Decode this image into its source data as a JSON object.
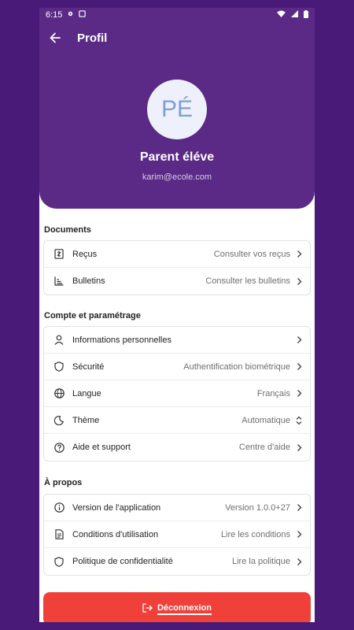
{
  "status_bar": {
    "time": "6:15"
  },
  "app_bar": {
    "title": "Profil"
  },
  "profile": {
    "initials": "PÉ",
    "name": "Parent éléve",
    "email": "karim@ecole.com"
  },
  "sections": [
    {
      "title": "Documents",
      "items": [
        {
          "label": "Reçus",
          "value": "Consulter vos reçus",
          "icon": "receipt-icon",
          "chevron": "chevron-right-icon"
        },
        {
          "label": "Bulletins",
          "value": "Consulter les bulletins",
          "icon": "bar-chart-icon",
          "chevron": "chevron-right-icon"
        }
      ]
    },
    {
      "title": "Compte et paramétrage",
      "items": [
        {
          "label": "Informations personnelles",
          "value": "",
          "icon": "person-icon",
          "chevron": "chevron-right-icon"
        },
        {
          "label": "Sécurité",
          "value": "Authentification biométrique",
          "icon": "shield-icon",
          "chevron": "chevron-right-icon"
        },
        {
          "label": "Langue",
          "value": "Français",
          "icon": "globe-icon",
          "chevron": "chevron-right-icon"
        },
        {
          "label": "Thème",
          "value": "Automatique",
          "icon": "moon-icon",
          "chevron": "chevron-updown-icon"
        },
        {
          "label": "Aide et support",
          "value": "Centre d'aide",
          "icon": "help-circle-icon",
          "chevron": "chevron-right-icon"
        }
      ]
    },
    {
      "title": "À propos",
      "items": [
        {
          "label": "Version de l'application",
          "value": "Version 1.0.0+27",
          "icon": "info-icon",
          "chevron": "chevron-right-icon"
        },
        {
          "label": "Conditions d'utilisation",
          "value": "Lire les conditions",
          "icon": "document-icon",
          "chevron": "chevron-right-icon"
        },
        {
          "label": "Politique de confidentialité",
          "value": "Lire la politique",
          "icon": "shield-icon",
          "chevron": "chevron-right-icon"
        }
      ]
    }
  ],
  "logout": {
    "label": "Déconnexion",
    "icon": "logout-icon"
  },
  "colors": {
    "background": "#4a1a78",
    "header": "#5a2a86",
    "logout": "#f0403a",
    "avatar_bg": "#eef1fb",
    "avatar_text": "#7d9ed8"
  }
}
